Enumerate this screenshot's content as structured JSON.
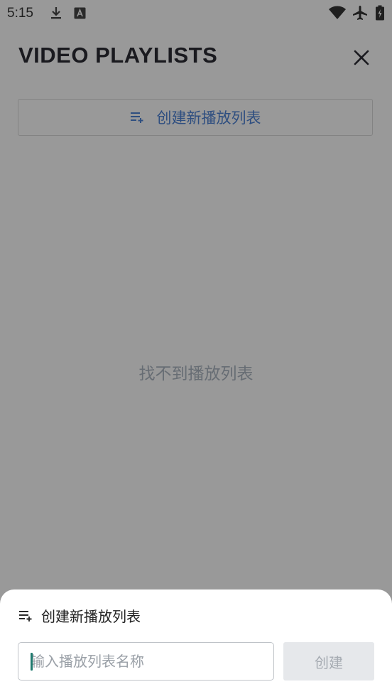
{
  "status_bar": {
    "time": "5:15",
    "left_icons": [
      "download-icon",
      "font-a-icon"
    ],
    "right_icons": [
      "wifi-icon",
      "airplane-icon",
      "battery-charging-icon"
    ]
  },
  "header": {
    "title": "VIDEO PLAYLISTS",
    "close_icon": "close-icon"
  },
  "create_button": {
    "icon": "playlist-add-icon",
    "label": "创建新播放列表"
  },
  "empty_state": {
    "text": "找不到播放列表"
  },
  "sheet": {
    "icon": "playlist-add-icon",
    "title": "创建新播放列表",
    "input": {
      "value": "",
      "placeholder": "输入播放列表名称"
    },
    "submit_label": "创建"
  },
  "colors": {
    "overlay": "#999999",
    "accent_text": "#2e4e80",
    "sheet_bg": "#ffffff",
    "caret": "#1f7a6e",
    "disabled_button": "#e6e8eb"
  }
}
